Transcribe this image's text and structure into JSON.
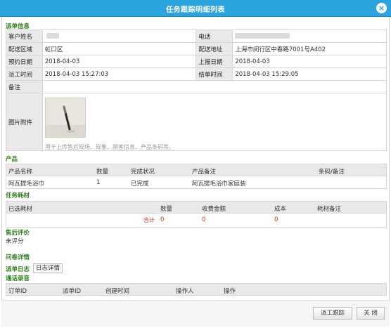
{
  "window": {
    "title": "任务跟踪明细列表",
    "close_icon": "close-icon"
  },
  "dispatch": {
    "section_label": "派单信息",
    "customer_name_label": "客户姓名",
    "phone_label": "电话",
    "area_label": "配送区域",
    "area_value": "虹口区",
    "address_label": "配送地址",
    "address_value": "上海市闵行区中春路7001号A402",
    "appointment_label": "预约日期",
    "appointment_value": "2018-04-03",
    "report_label": "上报日期",
    "report_value": "2018-04-03",
    "dispatch_time_label": "派工时间",
    "dispatch_time_value": "2018-04-03 15:27:03",
    "close_time_label": "结单时间",
    "close_time_value": "2018-04-03 15:29:05",
    "remark_label": "备注",
    "attachment_label": "图片附件",
    "attachment_hint": "用于上传售后现场、现象、顾客信息、产品条码等。"
  },
  "product": {
    "section_label": "产品",
    "headers": [
      "产品名称",
      "数量",
      "完成状况",
      "产品备注",
      "条码/备注"
    ],
    "rows": [
      {
        "name": "阿瓦提毛浴巾",
        "qty": "1",
        "status": "已完成",
        "remark": "阿瓦提毛浴巾家庭装",
        "barcode": ""
      }
    ]
  },
  "consumables": {
    "section_label": "任务耗材",
    "headers": [
      "已选耗材",
      "数量",
      "收费金额",
      "成本",
      "耗材备注"
    ],
    "total_label": "合计",
    "total_qty": "0",
    "total_fee": "0",
    "total_cost": "0"
  },
  "review": {
    "section_label": "售后评价",
    "value": "未评分"
  },
  "survey": {
    "section_label": "问卷详情"
  },
  "dispatch_log": {
    "label": "派单日志",
    "tab_label": "日志详情"
  },
  "call_record": {
    "section_label": "通话录音",
    "headers": [
      "订单ID",
      "派单ID",
      "创建时间",
      "操作人",
      "操作"
    ]
  },
  "buttons": {
    "follow_label": "派工跟踪",
    "close_label": "关 闭"
  }
}
